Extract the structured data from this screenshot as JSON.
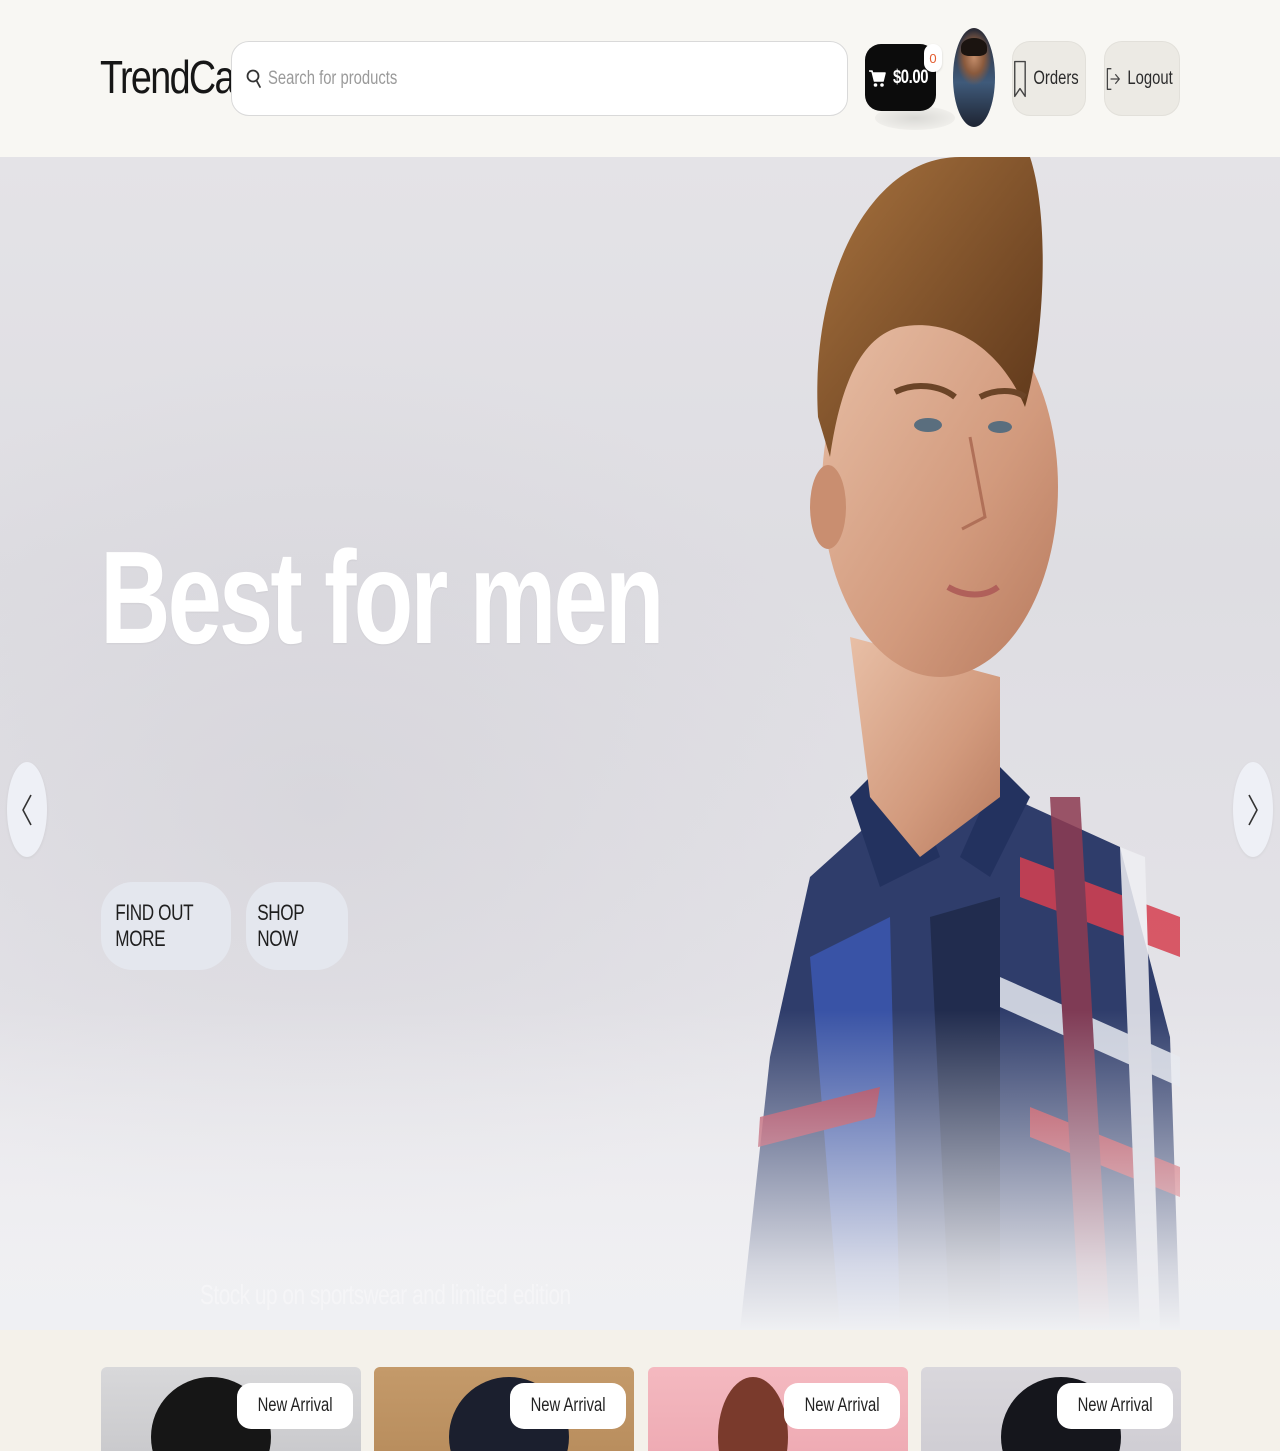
{
  "header": {
    "logo": "TrendCart",
    "search_placeholder": "Search for products",
    "cart_total": "$0.00",
    "cart_count": "0",
    "orders_label": "Orders",
    "logout_label": "Logout"
  },
  "hero": {
    "title": "Best for men",
    "subtitle": "Stock up on sportswear and limited edition collections on our awesome mid-season sale.",
    "find_out_more_label": "FIND OUT MORE",
    "shop_now_label": "SHOP NOW"
  },
  "products": [
    {
      "badge": "New Arrival"
    },
    {
      "badge": "New Arrival"
    },
    {
      "badge": "New Arrival"
    },
    {
      "badge": "New Arrival"
    }
  ],
  "icons": {
    "search": "search-icon",
    "cart": "cart-icon",
    "orders": "bookmark-icon",
    "logout": "logout-icon",
    "prev": "chevron-left-icon",
    "next": "chevron-right-icon"
  }
}
